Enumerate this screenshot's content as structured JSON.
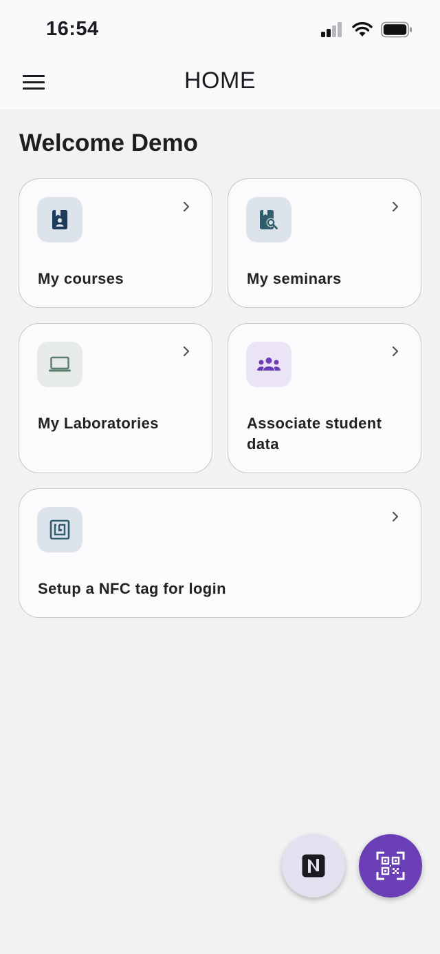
{
  "status_bar": {
    "time": "16:54"
  },
  "app_bar": {
    "title": "HOME"
  },
  "welcome": "Welcome Demo",
  "cards": [
    {
      "label": "My courses",
      "icon": "course-book-icon",
      "icon_bg": "#dde3ea",
      "icon_color": "#1f3b5c"
    },
    {
      "label": "My seminars",
      "icon": "seminar-search-icon",
      "icon_bg": "#dde3ea",
      "icon_color": "#2f5d6b"
    },
    {
      "label": "My Laboratories",
      "icon": "laptop-icon",
      "icon_bg": "#e6ebe8",
      "icon_color": "#5d7b6c"
    },
    {
      "label": "Associate student data",
      "icon": "people-group-icon",
      "icon_bg": "#eae4f5",
      "icon_color": "#6a3fb5"
    },
    {
      "label": "Setup a NFC tag for login",
      "icon": "nfc-tag-icon",
      "icon_bg": "#dde3ea",
      "icon_color": "#2f5d6b"
    }
  ],
  "fabs": [
    {
      "name": "nfc-fab",
      "icon": "nfc-icon",
      "bg": "#e4e0f0",
      "color": "#1c1b1f"
    },
    {
      "name": "qr-scan-fab",
      "icon": "qr-code-scan-icon",
      "bg": "#6a3fb5",
      "color": "#ffffff"
    }
  ]
}
